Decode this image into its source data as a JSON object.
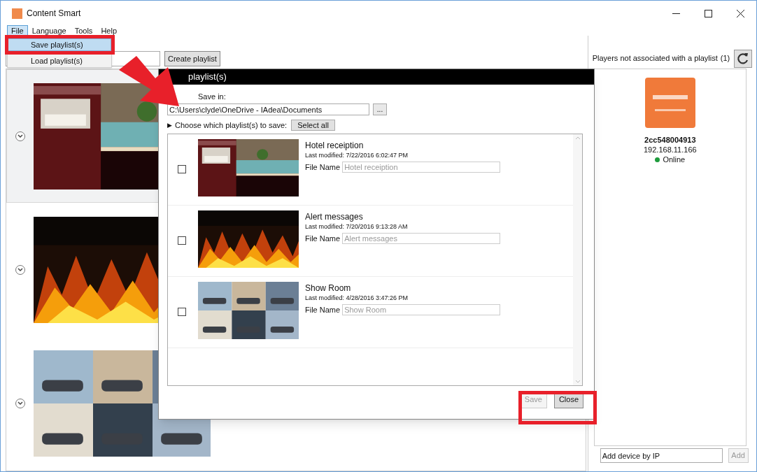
{
  "window": {
    "title": "Content Smart"
  },
  "menu": [
    {
      "label": "File",
      "selected": true
    },
    {
      "label": "Language",
      "selected": false
    },
    {
      "label": "Tools",
      "selected": false
    },
    {
      "label": "Help",
      "selected": false
    }
  ],
  "file_menu": [
    {
      "label": "Save playlist(s)",
      "selected": true
    },
    {
      "label": "Load playlist(s)",
      "selected": false
    }
  ],
  "toolbar": {
    "create_button": "Create playlist"
  },
  "playlists": [
    {
      "selected": true
    },
    {
      "selected": false
    },
    {
      "selected": false
    }
  ],
  "players_panel": {
    "title": "Players not associated with a playlist",
    "count": "(1)",
    "players": [
      {
        "name": "2cc548004913",
        "ip": "192.168.11.166",
        "status": "Online",
        "color": "#1e9b3c"
      }
    ],
    "add_field": {
      "value": "Add device by IP"
    },
    "add_button": "Add"
  },
  "dialog": {
    "title": "playlist(s)",
    "save_in_label": "Save in:",
    "path": "C:\\Users\\clyde\\OneDrive - IAdea\\Documents",
    "browse_button": "...",
    "choose_label": "Choose which playlist(s) to save:",
    "expand_icon": "▶",
    "select_all_button": "Select all",
    "rows": [
      {
        "name": "Hotel receiption",
        "last_modified": "Last modified: 7/22/2016 6:02:47 PM",
        "file_name_label": "File Name",
        "placeholder": "Hotel receiption",
        "checked": false
      },
      {
        "name": "Alert messages",
        "last_modified": "Last modified: 7/20/2016 9:13:28 AM",
        "file_name_label": "File Name",
        "placeholder": "Alert messages",
        "checked": false
      },
      {
        "name": "Show Room",
        "last_modified": "Last modified: 4/28/2016 3:47:26 PM",
        "file_name_label": "File Name",
        "placeholder": "Show Room",
        "checked": false
      }
    ],
    "buttons": [
      {
        "label": "Save",
        "disabled": true
      },
      {
        "label": "Close",
        "disabled": false
      }
    ]
  }
}
